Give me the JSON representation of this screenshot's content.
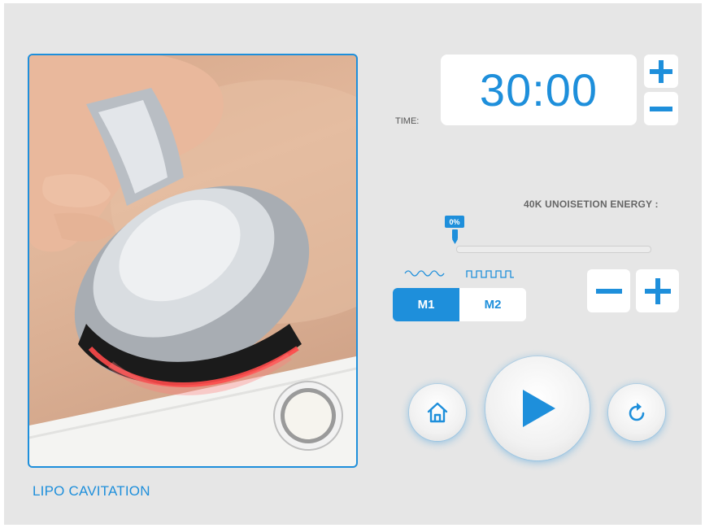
{
  "photo": {
    "label": "LIPO CAVITATION"
  },
  "timer": {
    "label": "TIME:",
    "value": "30:00"
  },
  "energy": {
    "label": "40K UNOISETION ENERGY :",
    "value": "0%",
    "level": 0
  },
  "modes": {
    "items": [
      {
        "label": "M1",
        "active": true
      },
      {
        "label": "M2",
        "active": false
      }
    ]
  },
  "icons": {
    "time_increase": "plus-icon",
    "time_decrease": "minus-icon",
    "energy_decrease": "minus-icon",
    "energy_increase": "plus-icon",
    "mode1_wave": "sine-wave-icon",
    "mode2_wave": "square-wave-icon",
    "home": "home-icon",
    "play": "play-icon",
    "reset": "refresh-icon"
  },
  "colors": {
    "accent": "#1e8fdb",
    "background": "#e6e6e6"
  }
}
